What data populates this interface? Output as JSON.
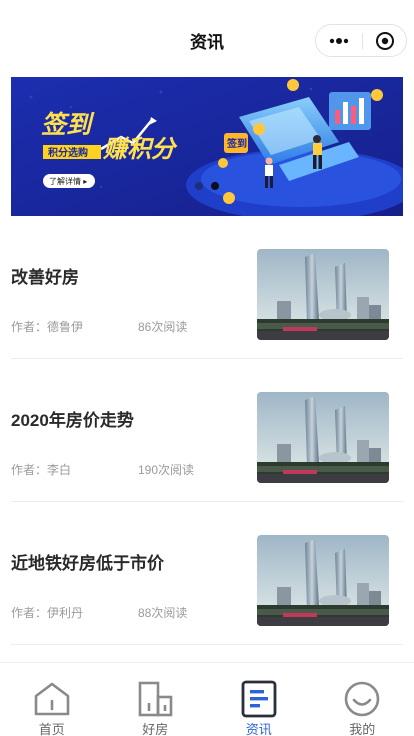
{
  "navbar": {
    "title": "资讯"
  },
  "banner": {
    "headline_1": "签到",
    "headline_2": "赚积分",
    "sub": "积分选购",
    "cta": "了解详情 ▸",
    "sign_label": "签到",
    "slide_count": 2,
    "active_slide": 1
  },
  "news": [
    {
      "title": "改善好房",
      "author": "作者：德鲁伊",
      "reads": "86次阅读"
    },
    {
      "title": "2020年房价走势",
      "author": "作者：李白",
      "reads": "190次阅读"
    },
    {
      "title": "近地铁好房低于市价",
      "author": "作者：伊利丹",
      "reads": "88次阅读"
    }
  ],
  "tabbar": {
    "active": "tab-news",
    "items": [
      {
        "label": "首页",
        "icon": "home-icon"
      },
      {
        "label": "好房",
        "icon": "building-icon"
      },
      {
        "label": "资讯",
        "icon": "news-icon"
      },
      {
        "label": "我的",
        "icon": "smile-icon"
      }
    ]
  },
  "colors": {
    "accent": "#2b63d9",
    "banner_bg": "#1a2a9c",
    "headline": "#ffe14d"
  }
}
